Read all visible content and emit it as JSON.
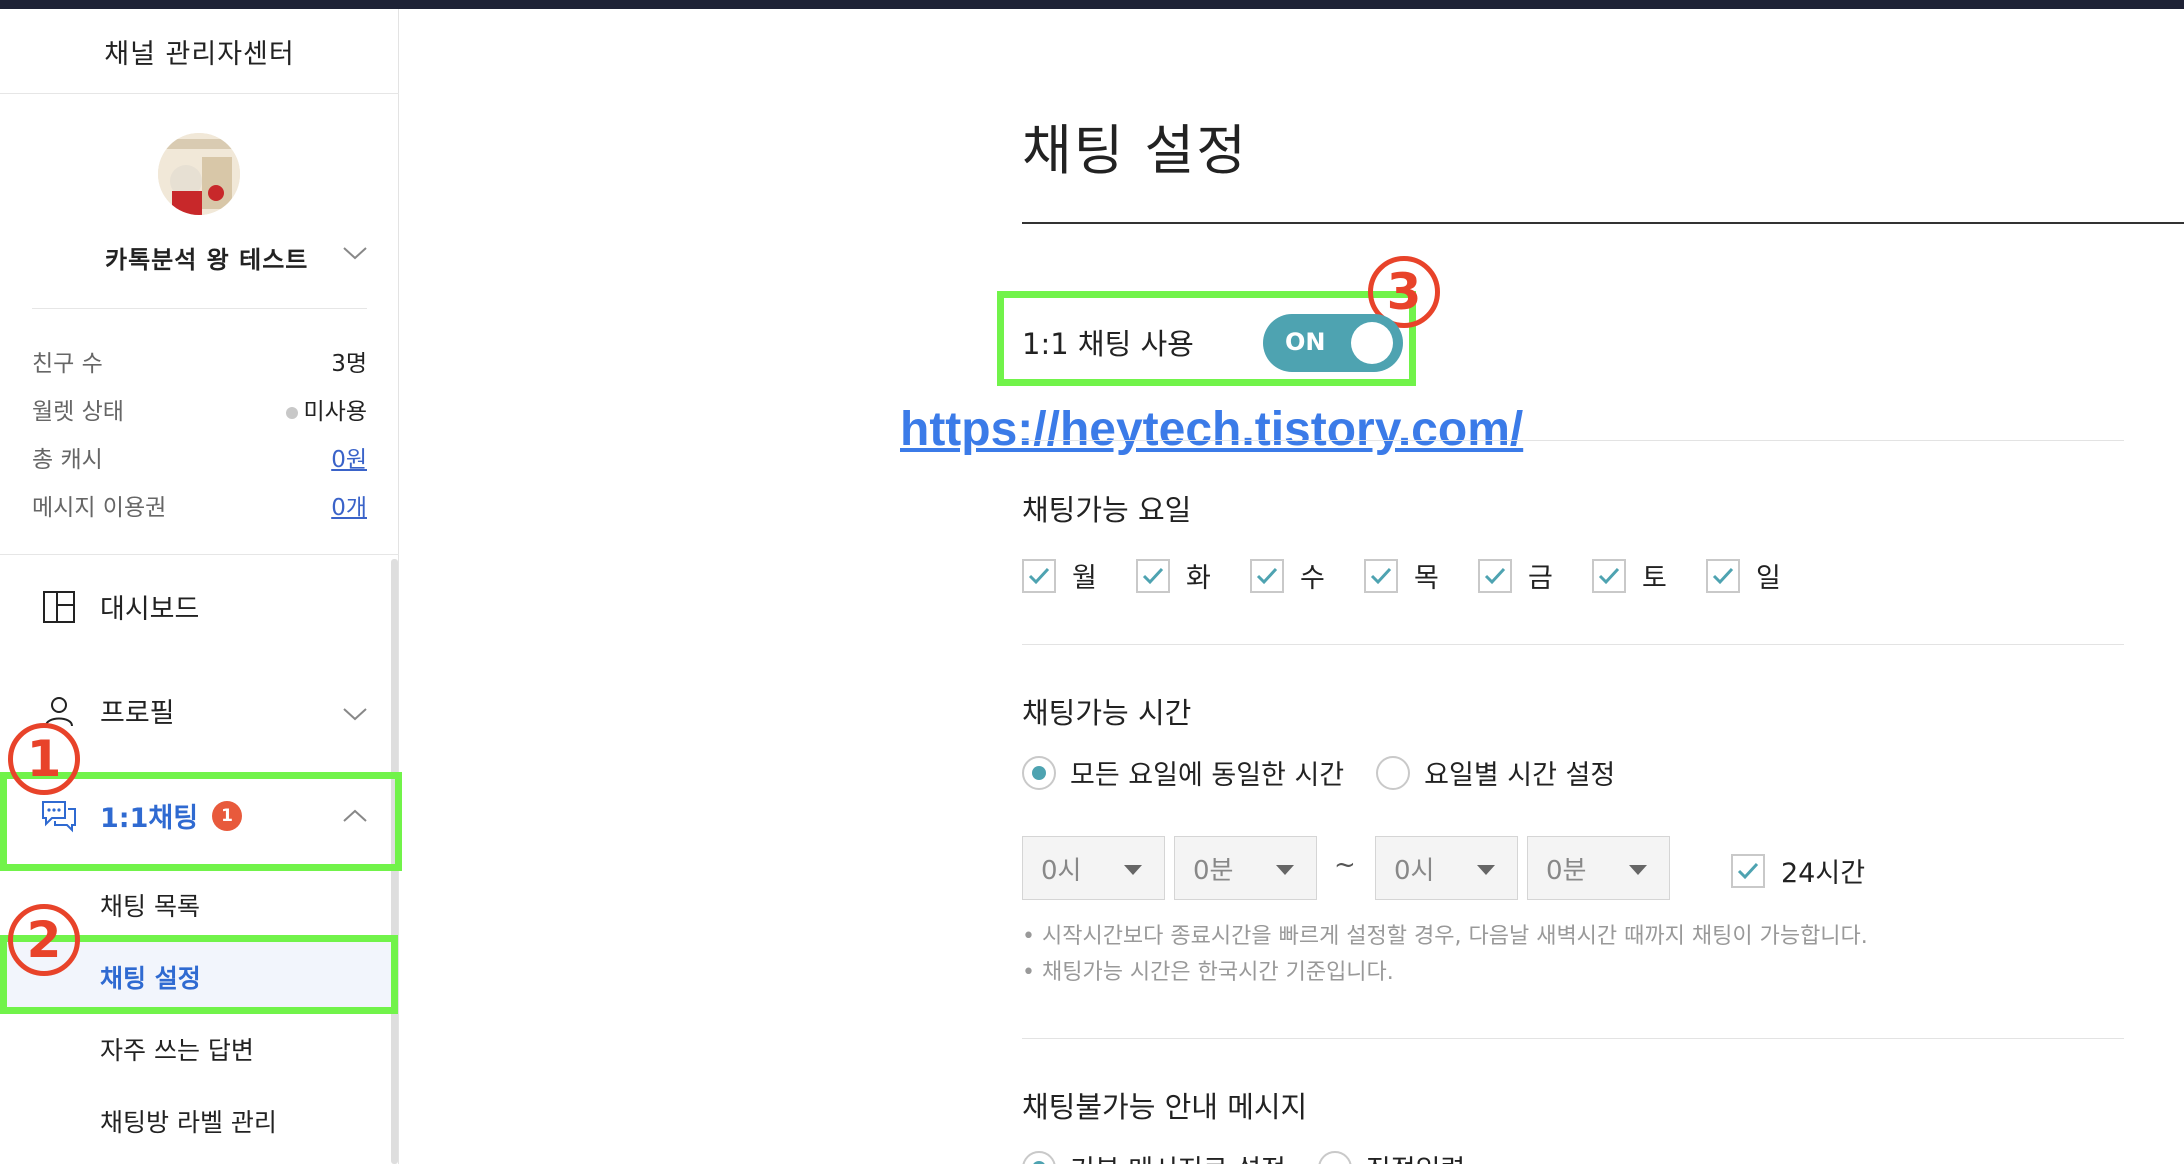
{
  "sidebar": {
    "title": "채널 관리자센터",
    "channel_name": "카톡분석 왕 테스트",
    "stats": [
      {
        "label": "친구 수",
        "value": "3명",
        "link": false
      },
      {
        "label": "월렛 상태",
        "value": "미사용",
        "link": false
      },
      {
        "label": "총 캐시",
        "value": "0원",
        "link": true
      },
      {
        "label": "메시지 이용권",
        "value": "0개",
        "link": true
      }
    ],
    "nav": [
      {
        "label": "대시보드",
        "icon": "dashboard-icon"
      },
      {
        "label": "프로필",
        "icon": "person-icon"
      },
      {
        "label": "1:1채팅",
        "icon": "chat-icon",
        "badge": "1"
      }
    ],
    "sub_items": [
      "채팅 목록",
      "채팅 설정",
      "자주 쓰는 답변",
      "채팅방 라벨 관리"
    ]
  },
  "annotations": {
    "one": "1",
    "two": "2",
    "three": "3"
  },
  "main": {
    "title": "채팅 설정",
    "toggle_label": "1:1 채팅 사용",
    "toggle_state": "ON",
    "watermark": "https://heytech.tistory.com/",
    "days_title": "채팅가능 요일",
    "days": [
      "월",
      "화",
      "수",
      "목",
      "금",
      "토",
      "일"
    ],
    "time_title": "채팅가능 시간",
    "time_options": [
      "모든 요일에 동일한 시간",
      "요일별 시간 설정"
    ],
    "start_hour": "0시",
    "start_min": "0분",
    "tilde": "~",
    "end_hour": "0시",
    "end_min": "0분",
    "all_day_label": "24시간",
    "notes": [
      "• 시작시간보다 종료시간을 빠르게 설정할 경우, 다음날 새벽시간 때까지 채팅이 가능합니다.",
      "• 채팅가능 시간은 한국시간 기준입니다."
    ],
    "unavailable_title": "채팅불가능 안내 메시지",
    "unavailable_options": [
      "기본 메시지로 설정",
      "직접입력"
    ]
  },
  "colors": {
    "accent": "#4ea3b1",
    "active_nav": "#2f6ad1",
    "highlight": "#71f34a",
    "annotation": "#e8432a"
  }
}
